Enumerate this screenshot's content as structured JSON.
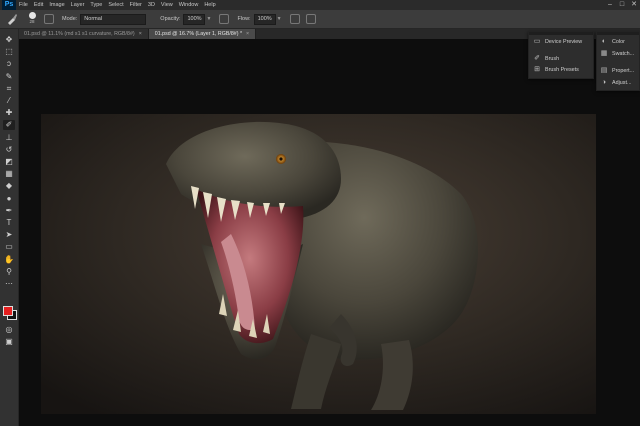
{
  "app": {
    "logo": "Ps",
    "menu": [
      "File",
      "Edit",
      "Image",
      "Layer",
      "Type",
      "Select",
      "Filter",
      "3D",
      "View",
      "Window",
      "Help"
    ],
    "window_controls": [
      "–",
      "□",
      "✕"
    ]
  },
  "options_bar": {
    "brush_size": "28",
    "mode_label": "Mode:",
    "mode_value": "Normal",
    "opacity_label": "Opacity:",
    "opacity_value": "100%",
    "flow_label": "Flow:",
    "flow_value": "100%"
  },
  "tabs": [
    {
      "label": "01.psd @ 11.1% (md s1 s1 curvature, RGB/8#)",
      "close": "×",
      "active": false
    },
    {
      "label": "01.psd @ 16.7% (Layer 1, RGB/8#) *",
      "close": "×",
      "active": true
    }
  ],
  "toolbox": {
    "tools": [
      {
        "name": "move-tool-icon",
        "glyph": "✥"
      },
      {
        "name": "marquee-tool-icon",
        "glyph": "⬚"
      },
      {
        "name": "lasso-tool-icon",
        "glyph": "ↄ"
      },
      {
        "name": "quick-select-tool-icon",
        "glyph": "✎"
      },
      {
        "name": "crop-tool-icon",
        "glyph": "⌗"
      },
      {
        "name": "eyedropper-tool-icon",
        "glyph": "⁄"
      },
      {
        "name": "healing-brush-tool-icon",
        "glyph": "✚"
      },
      {
        "name": "brush-tool-icon",
        "glyph": "✐",
        "active": true
      },
      {
        "name": "clone-stamp-tool-icon",
        "glyph": "⊥"
      },
      {
        "name": "history-brush-tool-icon",
        "glyph": "↺"
      },
      {
        "name": "eraser-tool-icon",
        "glyph": "◩"
      },
      {
        "name": "gradient-tool-icon",
        "glyph": "▦"
      },
      {
        "name": "blur-tool-icon",
        "glyph": "◆"
      },
      {
        "name": "dodge-tool-icon",
        "glyph": "●"
      },
      {
        "name": "pen-tool-icon",
        "glyph": "✒"
      },
      {
        "name": "type-tool-icon",
        "glyph": "T"
      },
      {
        "name": "path-select-tool-icon",
        "glyph": "➤"
      },
      {
        "name": "rectangle-tool-icon",
        "glyph": "▭"
      },
      {
        "name": "hand-tool-icon",
        "glyph": "✋"
      },
      {
        "name": "zoom-tool-icon",
        "glyph": "⚲"
      },
      {
        "name": "more-tools-icon",
        "glyph": "⋯"
      }
    ],
    "foreground_color": "#e41e1e",
    "background_color": "#111111"
  },
  "panels": {
    "left_column": [
      {
        "icon": "device-preview-icon",
        "glyph": "▭",
        "label": "Device Preview"
      },
      {
        "icon": "brush-panel-icon",
        "glyph": "✐",
        "label": "Brush"
      },
      {
        "icon": "brush-presets-icon",
        "glyph": "⊞",
        "label": "Brush Presets"
      }
    ],
    "right_column": [
      {
        "icon": "color-panel-icon",
        "glyph": "◐",
        "label": "Color"
      },
      {
        "icon": "swatches-panel-icon",
        "glyph": "▦",
        "label": "Swatch..."
      },
      {
        "icon": "properties-panel-icon",
        "glyph": "▤",
        "label": "Propert..."
      },
      {
        "icon": "adjustments-panel-icon",
        "glyph": "◑",
        "label": "Adjust..."
      }
    ],
    "collapse_glyph": "»"
  }
}
